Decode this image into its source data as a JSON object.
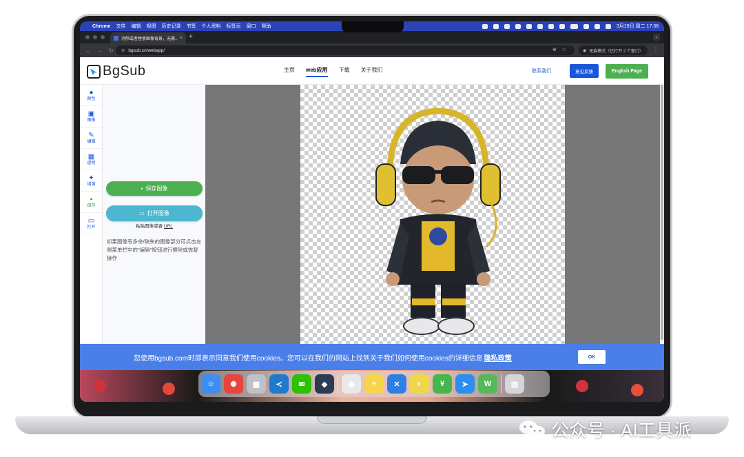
{
  "menubar": {
    "apple": "",
    "app_name": "Chrome",
    "menus": [
      "文件",
      "编辑",
      "视图",
      "历史记录",
      "书签",
      "个人资料",
      "标签页",
      "窗口",
      "帮助"
    ],
    "status_icons": [
      "w-icon",
      "shield-icon",
      "sun-icon",
      "bar-icon",
      "grid-icon",
      "wechat-icon",
      "send-icon",
      "clock-icon",
      "battery-icon",
      "wifi-icon",
      "screen-icon",
      "control-center-icon"
    ],
    "battery": "",
    "datetime": "3月19日 周二 17:38"
  },
  "browser": {
    "tab_title": "消除或者替换图像背景，无需...",
    "tab_close": "×",
    "new_tab": "+",
    "url": "bgsub.cn/webapp/",
    "incognito": "无痕模式（已打开 2 个窗口）"
  },
  "site": {
    "logo_text": "BgSub",
    "nav": [
      "主页",
      "web应用",
      "下载",
      "关于我们"
    ],
    "contact": "联系我们",
    "feedback": "意见反馈",
    "english": "English Page"
  },
  "sidebar": {
    "items": [
      {
        "label": "颜色",
        "icon": "palette-icon",
        "glyph": "●"
      },
      {
        "label": "图像",
        "icon": "image-icon",
        "glyph": "▣"
      },
      {
        "label": "编辑",
        "icon": "pencil-icon",
        "glyph": "✎"
      },
      {
        "label": "透明",
        "icon": "transparent-icon",
        "glyph": "▦"
      },
      {
        "label": "增强",
        "icon": "sparkle-icon",
        "glyph": "✦"
      },
      {
        "label": "保存",
        "icon": "save-icon",
        "glyph": "▪"
      },
      {
        "label": "打开",
        "icon": "folder-icon",
        "glyph": "▭"
      }
    ]
  },
  "panel": {
    "save_button": "保存图像",
    "open_button": "打开图像",
    "paste_prefix": "粘贴图像或者 ",
    "paste_url": "URL",
    "hint": "如果图像有多余/缺失的图像部分可点击左侧菜单栏中的\"编辑\"按钮进行擦除或恢复操作"
  },
  "cookie": {
    "text": "您使用bgsub.com时即表示同意我们使用cookies。您可以在我们的网站上找到关于我们如何使用cookies的详细信息",
    "link": "隐私政策",
    "ok": "OK"
  },
  "dock": {
    "apps": [
      {
        "name": "finder-icon",
        "color": "#3d8ef0",
        "glyph": "☺"
      },
      {
        "name": "sunflower-icon",
        "color": "#e8453c",
        "glyph": "✺"
      },
      {
        "name": "launchpad-icon",
        "color": "#c0c0c8",
        "glyph": "▦"
      },
      {
        "name": "vscode-icon",
        "color": "#1f7acc",
        "glyph": "≺"
      },
      {
        "name": "wechat-icon",
        "color": "#2dc100",
        "glyph": "✉"
      },
      {
        "name": "cube-app-icon",
        "color": "#2b3a55",
        "glyph": "◆"
      },
      {
        "name": "chrome-icon",
        "color": "#e8e8e8",
        "glyph": "◉"
      },
      {
        "name": "notes-icon",
        "color": "#f7d54b",
        "glyph": "≡"
      },
      {
        "name": "xcode-tools-icon",
        "color": "#2f80e4",
        "glyph": "✕"
      },
      {
        "name": "lemon-icon",
        "color": "#f0d64b",
        "glyph": "◐"
      },
      {
        "name": "money-app-icon",
        "color": "#45b649",
        "glyph": "¥"
      },
      {
        "name": "arrow-app-icon",
        "color": "#2b8ff0",
        "glyph": "➤"
      },
      {
        "name": "w-app-icon",
        "color": "#57b85a",
        "glyph": "W"
      },
      {
        "name": "trash-icon",
        "color": "#d6d6d8",
        "glyph": "▥"
      }
    ]
  },
  "watermark": {
    "text": "公众号 · AI工具派"
  },
  "colors": {
    "menubar": "#2c43b8",
    "primary_blue": "#1a56db",
    "green": "#4caf50",
    "open_cyan": "#4db6d0",
    "cookie_bar": "#4a7ee8",
    "canvas_gray": "#777777"
  }
}
